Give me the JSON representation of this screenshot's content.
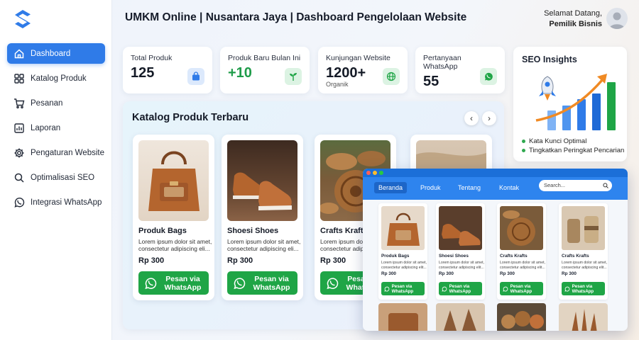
{
  "app": {
    "title": "UMKM Online | Nusantara Jaya | Dashboard Pengelolaan Website"
  },
  "user": {
    "greeting": "Selamat Datang,",
    "name": "Pemilik Bisnis"
  },
  "colors": {
    "primary": "#2f7be8",
    "whatsapp": "#1fa546",
    "nav_active": "#2f7be8"
  },
  "sidebar": {
    "items": [
      {
        "label": "Dashboard",
        "icon": "home-icon",
        "active": true
      },
      {
        "label": "Katalog Produk",
        "icon": "grid-icon",
        "active": false
      },
      {
        "label": "Pesanan",
        "icon": "cart-icon",
        "active": false
      },
      {
        "label": "Laporan",
        "icon": "chart-icon",
        "active": false
      },
      {
        "label": "Pengaturan Website",
        "icon": "gear-icon",
        "active": false
      },
      {
        "label": "Optimalisasi SEO",
        "icon": "search-icon",
        "active": false
      },
      {
        "label": "Integrasi WhatsApp",
        "icon": "whatsapp-icon",
        "active": false
      }
    ]
  },
  "stats": [
    {
      "label": "Total Produk",
      "value": "125",
      "sub": "",
      "icon": "shopping-bag-icon"
    },
    {
      "label": "Produk Baru Bulan Ini",
      "value": "+10",
      "sub": "",
      "icon": "plant-icon"
    },
    {
      "label": "Kunjungan Website",
      "value": "1200+",
      "sub": "Organik",
      "icon": "globe-icon"
    },
    {
      "label": "Pertanyaan WhatsApp",
      "value": "55",
      "sub": "",
      "icon": "whatsapp-icon"
    }
  ],
  "seo": {
    "title": "SEO Insights",
    "points": [
      "Kata Kunci Optimal",
      "Tingkatkan Peringkat Pencarian"
    ]
  },
  "catalog": {
    "title": "Katalog Produk Terbaru",
    "products": [
      {
        "name": "Produk Bags",
        "desc": "Lorem ipsum dolor sit amet, consectetur adipiscing eli...",
        "price": "Rp 300",
        "button": "Pesan via WhatsApp"
      },
      {
        "name": "Shoesi Shoes",
        "desc": "Lorem ipsum dolor sit amet, consectetur adipiscing eli...",
        "price": "Rp 300",
        "button": "Pesan via WhatsApp"
      },
      {
        "name": "Crafts Krafts",
        "desc": "Lorem ipsum dolor sit amet, consectetur adipiscing eli...",
        "price": "Rp 300",
        "button": "Pesan via WhatsApp"
      }
    ]
  },
  "preview": {
    "nav": [
      "Beranda",
      "Produk",
      "Tentang",
      "Kontak"
    ],
    "search_placeholder": "Search...",
    "products": [
      {
        "name": "Produk Bags",
        "desc": "Lorem ipsum dolor sit amet, consectetur adipiscing elit...",
        "price": "Rp 300",
        "button": "Pesan via WhatsApp"
      },
      {
        "name": "Shoesi Shoes",
        "desc": "Lorem ipsum dolor sit amet, consectetur adipiscing elit...",
        "price": "Rp 300",
        "button": "Pesan via WhatsApp"
      },
      {
        "name": "Crafts Krafts",
        "desc": "Lorem ipsum dolor sit amet, consectetur adipiscing elit...",
        "price": "Rp 300",
        "button": "Pesan via WhatsApp"
      },
      {
        "name": "Crafts Krafts",
        "desc": "Lorem ipsum dolor sit amet, consectetur adipiscing elit...",
        "price": "Rp 300",
        "button": "Pesan via WhatsApp"
      }
    ]
  }
}
